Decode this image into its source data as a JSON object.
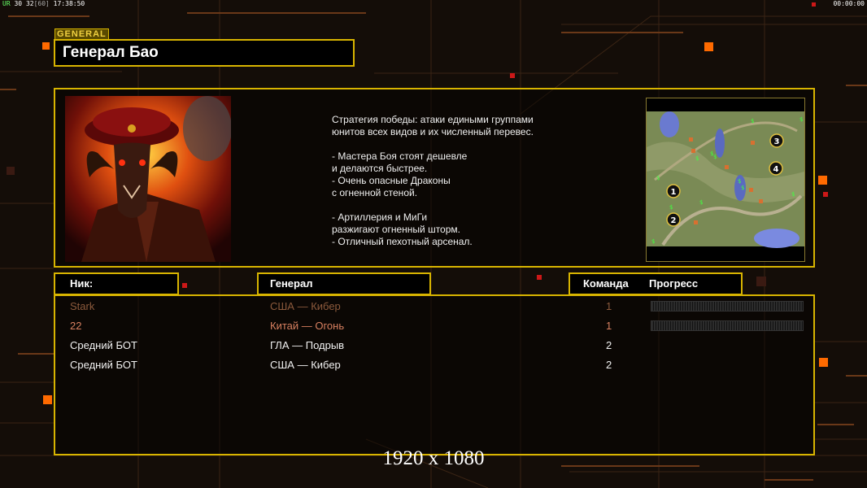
{
  "hud": {
    "left_a": "UR",
    "left_b": "30",
    "left_c": "32",
    "left_d": "[60]",
    "left_e": "17:38:50",
    "right": "00:00:00"
  },
  "general_tag": "GENERAL",
  "general_name": "Генерал Бао",
  "strategy_text": "Стратегия победы: атаки едиными группами\nюнитов всех видов и их численный перевес.\n\n- Мастера Боя стоят дешевле\nи делаются быстрее.\n- Очень опасные Драконы\nс огненной стеной.\n\n- Артиллерия и МиГи\nразжигают огненный шторм.\n- Отличный пехотный арсенал.",
  "minimap": {
    "start_positions": [
      "1",
      "2",
      "3",
      "4"
    ],
    "supply_marker": "$"
  },
  "columns": {
    "nick": "Ник:",
    "general": "Генерал",
    "team": "Команда",
    "progress": "Прогресс"
  },
  "players": [
    {
      "nick": "Stark",
      "general": "США — Кибер",
      "team": "1",
      "color": "#8c5a3c",
      "progress": 0
    },
    {
      "nick": "22",
      "general": "Китай — Огонь",
      "team": "1",
      "color": "#d88060",
      "progress": 0
    },
    {
      "nick": "Средний БОТ",
      "general": "ГЛА — Подрыв",
      "team": "2",
      "color": "#f2f2f2",
      "progress": null
    },
    {
      "nick": "Средний БОТ",
      "general": "США — Кибер",
      "team": "2",
      "color": "#f2f2f2",
      "progress": null
    }
  ],
  "resolution_label": "1920 x 1080",
  "colors": {
    "accent": "#d8b400",
    "background": "#140d08",
    "orange_square": "#ff6a00"
  }
}
